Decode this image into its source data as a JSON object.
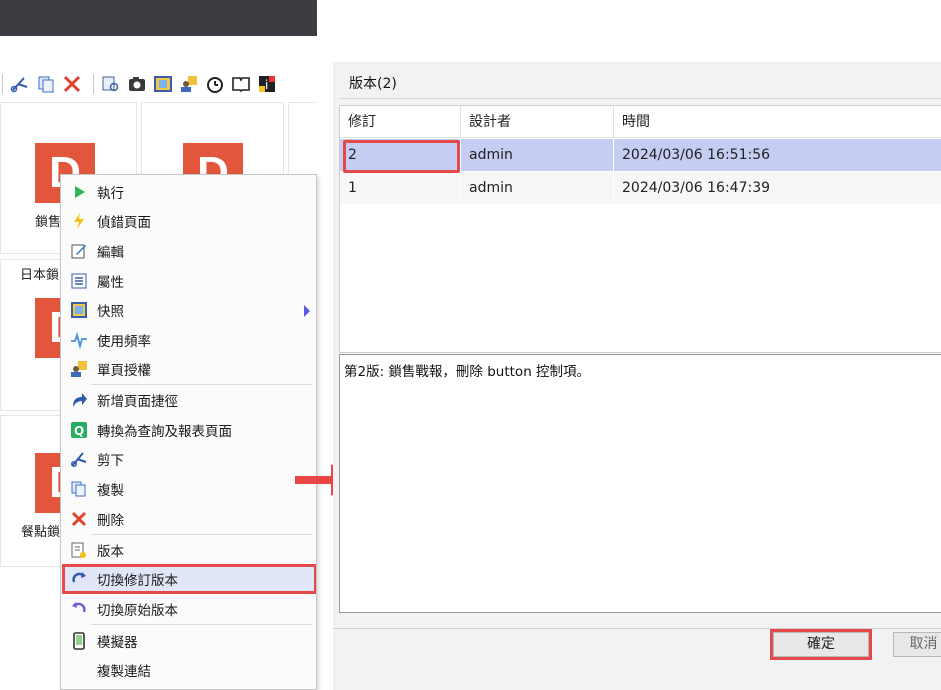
{
  "toolbar": {
    "icons": [
      "cut-icon",
      "copy-icon",
      "delete-icon",
      "preview-icon",
      "snapshot-icon",
      "frame-icon",
      "permission-icon",
      "timer-icon",
      "book-icon",
      "info-icon"
    ]
  },
  "tiles": [
    {
      "letter": "D",
      "label": "鎖售"
    },
    {
      "letter": "D",
      "label": ""
    },
    {
      "letter": "D",
      "label": "日本鎖"
    },
    {
      "letter": "D",
      "label": "餐點鎖"
    }
  ],
  "context_menu": {
    "items": [
      {
        "label": "執行",
        "icon": "run-icon"
      },
      {
        "label": "偵錯頁面",
        "icon": "debug-icon"
      },
      {
        "label": "編輯",
        "icon": "edit-icon"
      },
      {
        "label": "屬性",
        "icon": "properties-icon"
      },
      {
        "label": "快照",
        "icon": "snapshot-icon"
      },
      {
        "label": "使用頻率",
        "icon": "usage-frequency-icon"
      },
      {
        "label": "單頁授權",
        "icon": "page-permission-icon"
      },
      {
        "label": "新增頁面捷徑",
        "icon": "shortcut-icon"
      },
      {
        "label": "轉換為查詢及報表頁面",
        "icon": "query-icon"
      },
      {
        "label": "剪下",
        "icon": "cut-icon"
      },
      {
        "label": "複製",
        "icon": "copy-icon"
      },
      {
        "label": "刪除",
        "icon": "delete-icon"
      },
      {
        "label": "版本",
        "icon": "version-icon"
      },
      {
        "label": "切換修訂版本",
        "icon": "switch-revision-icon"
      },
      {
        "label": "切換原始版本",
        "icon": "switch-original-icon"
      },
      {
        "label": "模擬器",
        "icon": "emulator-icon"
      },
      {
        "label": "複製連結",
        "icon": ""
      }
    ]
  },
  "dialog": {
    "title": "版本(2)",
    "columns": [
      "修訂",
      "設計者",
      "時間"
    ],
    "rows": [
      {
        "revision": "2",
        "designer": "admin",
        "time": "2024/03/06 16:51:56"
      },
      {
        "revision": "1",
        "designer": "admin",
        "time": "2024/03/06 16:47:39"
      }
    ],
    "note": "第2版: 鎖售戰報，刪除 button 控制項。",
    "ok_label": "確定",
    "cancel_label": "取消"
  },
  "colors": {
    "highlight": "#e44a4a",
    "tile_icon": "#e2573b",
    "selected_row": "#c5cdf3"
  }
}
